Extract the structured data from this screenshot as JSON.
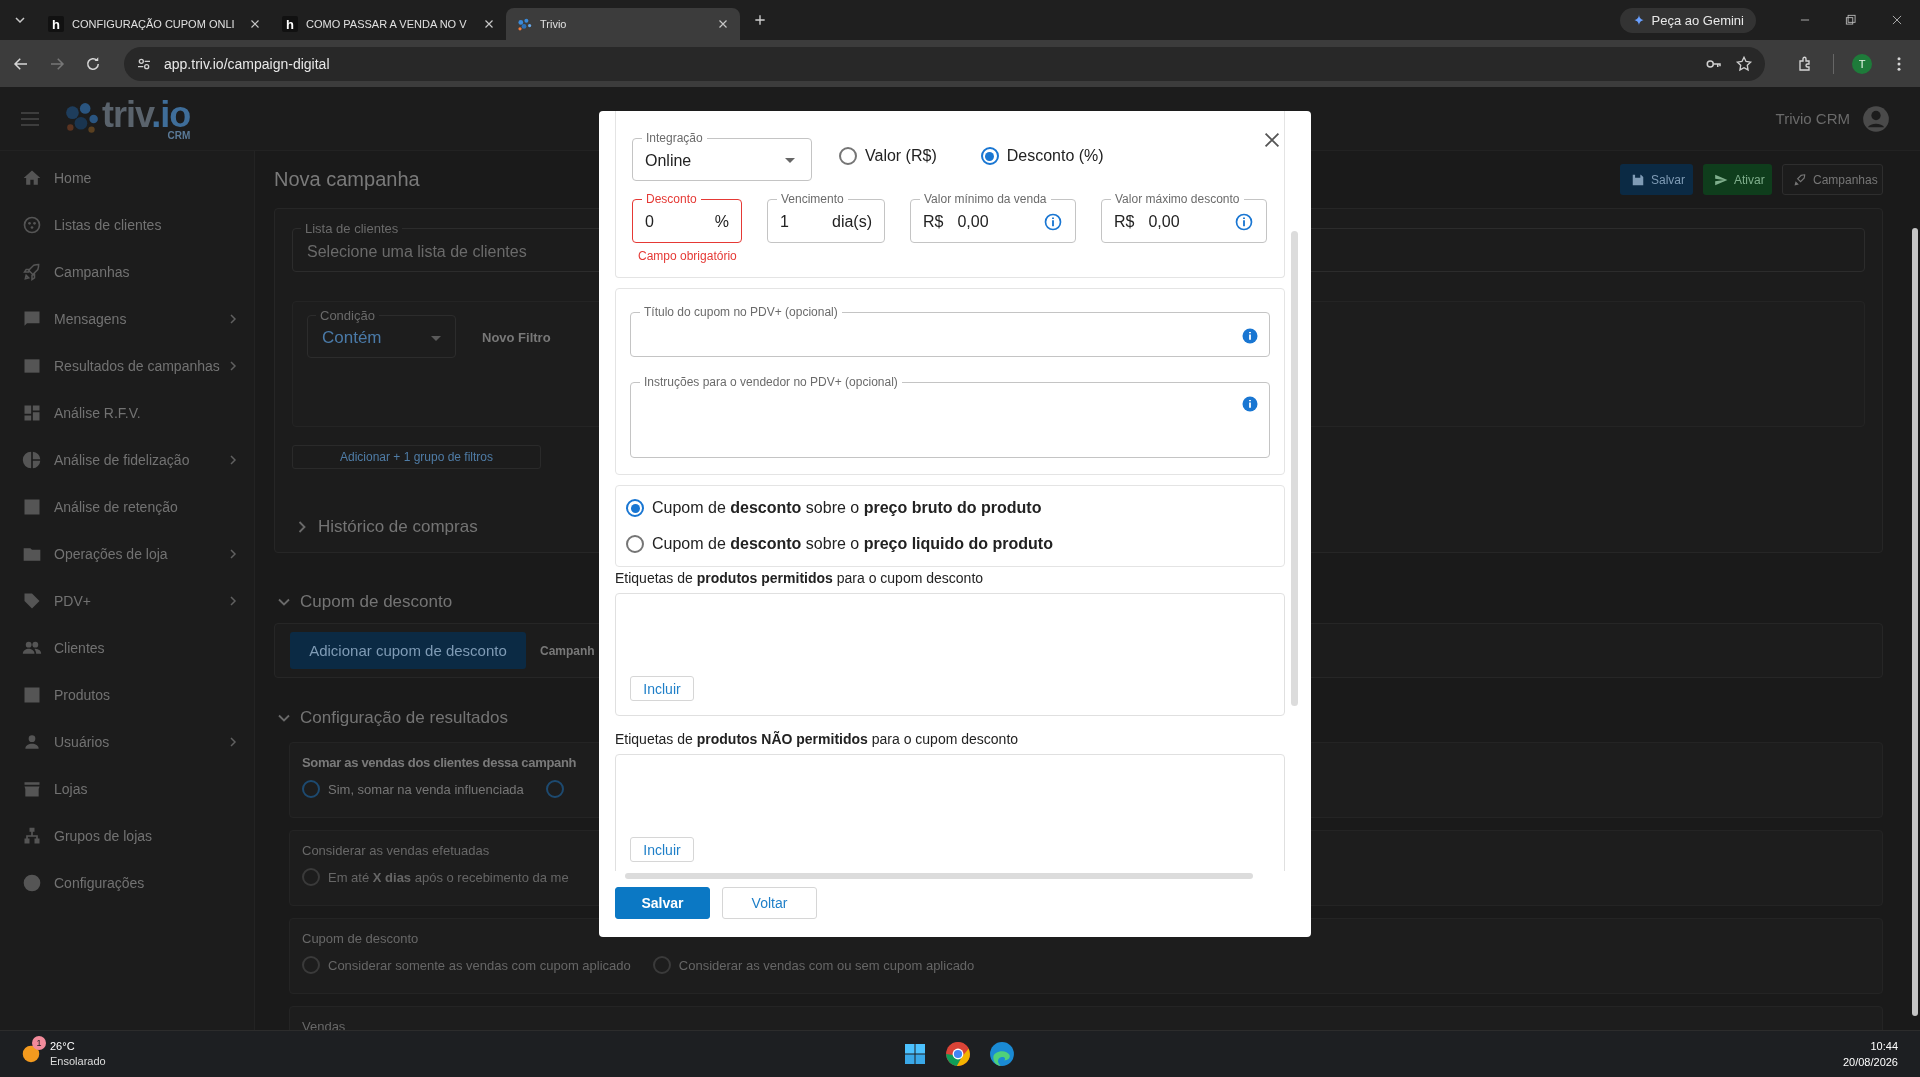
{
  "browser": {
    "tabs": [
      {
        "title": "CONFIGURAÇÃO CUPOM ONLI",
        "favicon": "h",
        "selected": false
      },
      {
        "title": "COMO PASSAR A VENDA NO V",
        "favicon": "h",
        "selected": false
      },
      {
        "title": "Trivio",
        "selected": true
      }
    ],
    "gemini": "Peça ao Gemini",
    "url": "app.triv.io/campaign-digital",
    "profile": "T"
  },
  "app": {
    "logo": {
      "name": "triv",
      "suffix": ".io",
      "sub": "CRM"
    },
    "account": "Trivio CRM",
    "sidebar": {
      "items": [
        {
          "label": "Home",
          "expandable": false
        },
        {
          "label": "Listas de clientes",
          "expandable": false
        },
        {
          "label": "Campanhas",
          "expandable": false
        },
        {
          "label": "Mensagens",
          "expandable": true
        },
        {
          "label": "Resultados de campanhas",
          "expandable": true
        },
        {
          "label": "Análise R.F.V.",
          "expandable": false
        },
        {
          "label": "Análise de fidelização",
          "expandable": true
        },
        {
          "label": "Análise de retenção",
          "expandable": false
        },
        {
          "label": "Operações de loja",
          "expandable": true
        },
        {
          "label": "PDV+",
          "expandable": true
        },
        {
          "label": "Clientes",
          "expandable": false
        },
        {
          "label": "Produtos",
          "expandable": false
        },
        {
          "label": "Usuários",
          "expandable": true
        },
        {
          "label": "Lojas",
          "expandable": false
        },
        {
          "label": "Grupos de lojas",
          "expandable": false
        },
        {
          "label": "Configurações",
          "expandable": false
        }
      ]
    },
    "page": {
      "title": "Nova campanha",
      "header_buttons": [
        {
          "label": "Salvar",
          "kind": "primary"
        },
        {
          "label": "Ativar",
          "kind": "success"
        },
        {
          "label": "Campanhas",
          "kind": "outlined"
        }
      ],
      "client_list": {
        "label": "Lista de clientes",
        "placeholder": "Selecione uma lista de clientes"
      },
      "filter": {
        "label": "Condição",
        "value": "Contém",
        "new_filter": "Novo Filtro"
      },
      "add_group": "Adicionar + 1 grupo de filtros",
      "purchase_history": {
        "title": "Histórico de compras",
        "expanded": false
      },
      "coupon_section": {
        "title": "Cupom de desconto",
        "expanded": true,
        "button": "Adicionar cupom de desconto",
        "tab": "Campanh"
      },
      "results_section": {
        "title": "Configuração de resultados",
        "expanded": true,
        "groups": [
          {
            "title": "Somar as vendas dos clientes dessa campanh",
            "disabled": false,
            "options": [
              {
                "label": "Sim, somar na venda influenciada",
                "selected": false
              },
              {
                "selected": false
              }
            ]
          },
          {
            "title": "Considerar as vendas efetuadas",
            "disabled": true,
            "options": [
              {
                "label": "Em até **X dias** após o recebimento da me",
                "selected": false
              }
            ]
          },
          {
            "title": "Cupom de desconto",
            "disabled": true,
            "options": [
              {
                "label": "Considerar somente as vendas com cupom aplicado",
                "selected": false
              },
              {
                "label": "Considerar as vendas com ou sem cupom aplicado",
                "selected": false
              }
            ]
          },
          {
            "title": "Vendas",
            "disabled": true
          }
        ]
      }
    }
  },
  "modal": {
    "integration": {
      "label": "Integração",
      "value": "Online"
    },
    "type_options": [
      {
        "label": "Valor (R$)",
        "selected": false
      },
      {
        "label": "Desconto (%)",
        "selected": true
      }
    ],
    "fields": [
      {
        "label": "Desconto",
        "value": "0",
        "suffix": "%",
        "invalid": true,
        "error": "Campo obrigatório"
      },
      {
        "label": "Vencimento",
        "value": "1",
        "suffix": "dia(s)",
        "invalid": false
      },
      {
        "label": "Valor mínimo da venda",
        "prefix": "R$",
        "value": "0,00",
        "invalid": false,
        "info": true
      },
      {
        "label": "Valor máximo desconto",
        "prefix": "R$",
        "value": "0,00",
        "invalid": false,
        "info": true
      }
    ],
    "text_fields": [
      {
        "label": "Título do cupom no PDV+ (opcional)",
        "multiline": false,
        "info": true
      },
      {
        "label": "Instruções para o vendedor no PDV+ (opcional)",
        "multiline": true,
        "info": true
      }
    ],
    "price_options": [
      {
        "label": "Cupom de **desconto** sobre o **preço bruto do produto**",
        "selected": true
      },
      {
        "label": "Cupom de **desconto** sobre o **preço liquido do produto**",
        "selected": false
      }
    ],
    "tag_sections": [
      {
        "label": "Etiquetas de **produtos permitidos** para o cupom desconto",
        "button": "Incluir"
      },
      {
        "label": "Etiquetas de **produtos NÃO permitidos** para o cupom desconto",
        "button": "Incluir"
      }
    ],
    "buttons": [
      {
        "label": "Salvar",
        "kind": "primary"
      },
      {
        "label": "Voltar",
        "kind": "secondary"
      }
    ]
  },
  "taskbar": {
    "weather": {
      "temperature": "26°C",
      "condition": "Ensolarado",
      "badge": "1"
    },
    "time": "10:44",
    "date": "20/08/2026"
  }
}
